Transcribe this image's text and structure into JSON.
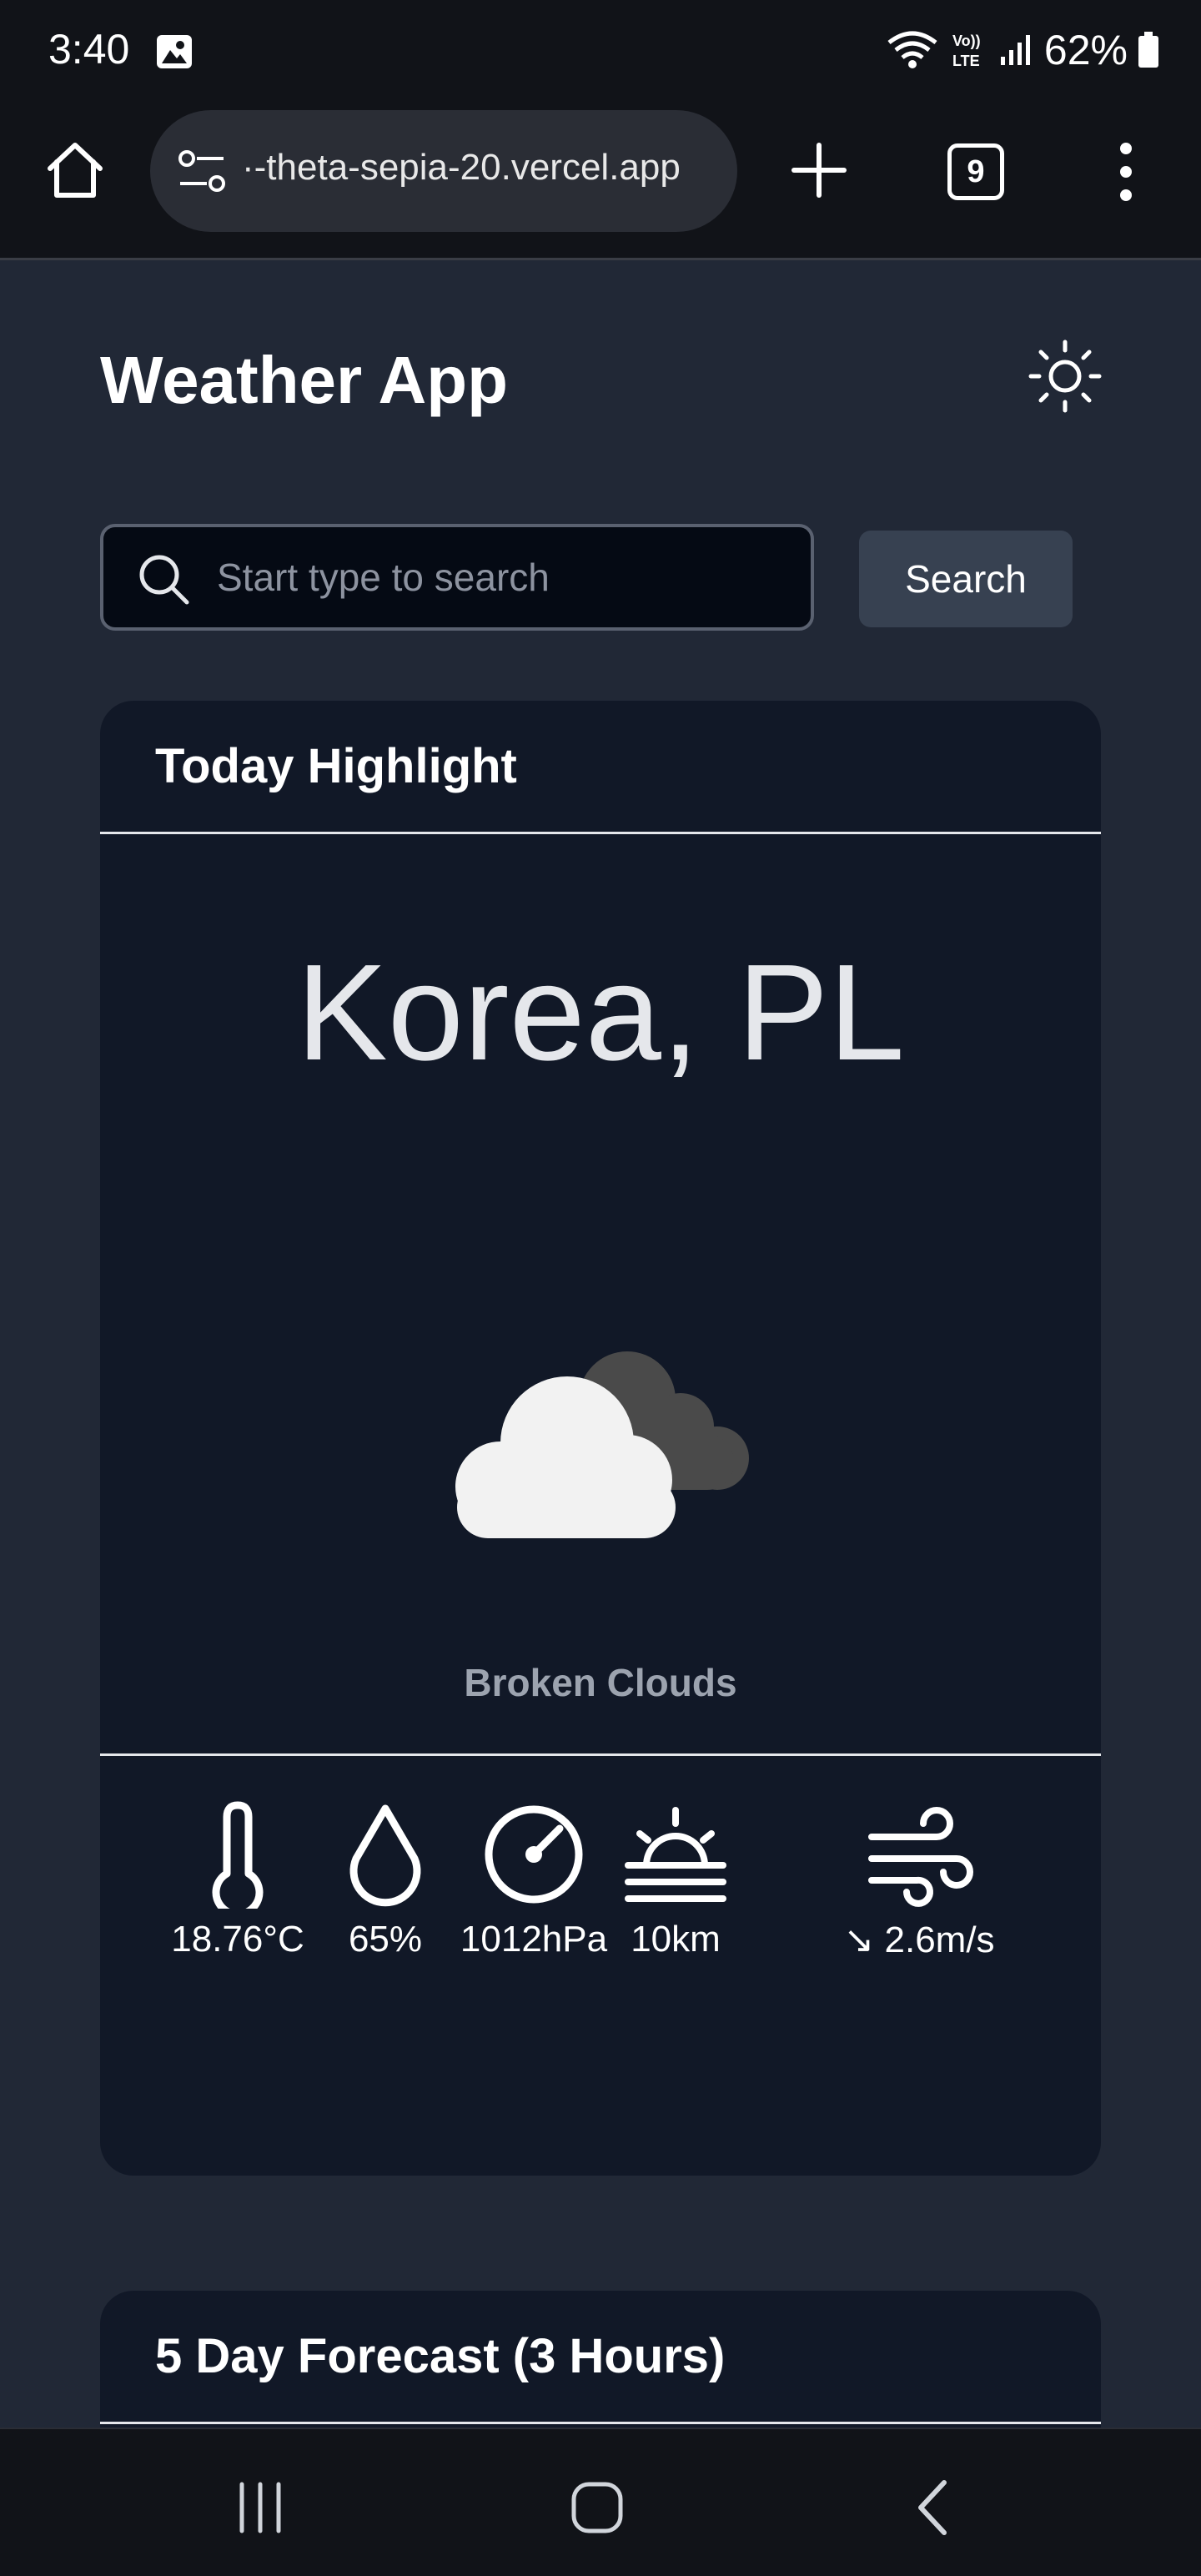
{
  "status_bar": {
    "time": "3:40",
    "battery": "62%",
    "icons": [
      "gallery-icon",
      "wifi-icon",
      "volte-icon",
      "signal-icon",
      "battery-icon"
    ]
  },
  "browser": {
    "url": "·-theta-sepia-20.vercel.app",
    "tab_count": "9"
  },
  "header": {
    "title": "Weather App"
  },
  "search": {
    "placeholder": "Start type to search",
    "button_label": "Search"
  },
  "highlight": {
    "title": "Today Highlight",
    "city": "Korea, PL",
    "description": "Broken Clouds",
    "weather_icon": "broken-clouds-icon",
    "stats": {
      "temperature": "18.76°C",
      "humidity": "65%",
      "pressure": "1012hPa",
      "visibility": "10km",
      "wind": "↘ 2.6m/s"
    }
  },
  "forecast": {
    "title": "5 Day Forecast (3 Hours)"
  },
  "colors": {
    "page_bg": "#212836",
    "card_bg": "#111827",
    "button_bg": "#374151",
    "muted_text": "#9ca3af"
  }
}
